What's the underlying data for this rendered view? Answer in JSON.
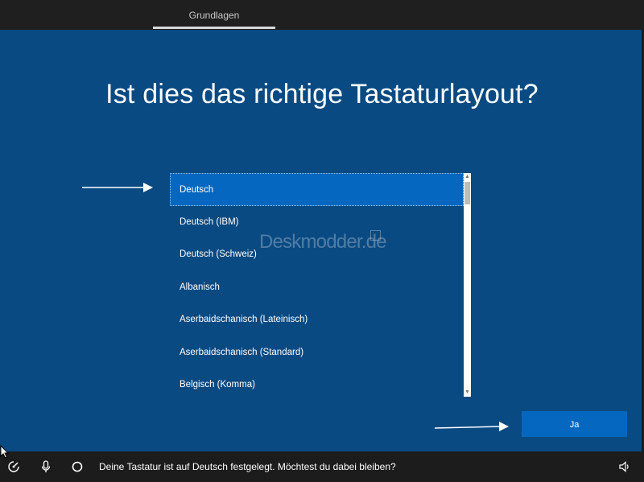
{
  "header": {
    "tab_label": "Grundlagen"
  },
  "main": {
    "title": "Ist dies das richtige Tastaturlayout?",
    "layouts": [
      "Deutsch",
      "Deutsch (IBM)",
      "Deutsch (Schweiz)",
      "Albanisch",
      "Aserbaidschanisch (Lateinisch)",
      "Aserbaidschanisch (Standard)",
      "Belgisch (Komma)"
    ],
    "selected_layout": "Deutsch",
    "confirm_button": "Ja",
    "watermark": "Deskmodder.de"
  },
  "footer": {
    "status_text": "Deine Tastatur ist auf Deutsch festgelegt. Möchtest du dabei bleiben?",
    "icons": [
      "ease-of-access-icon",
      "microphone-icon",
      "cortana-icon",
      "volume-icon"
    ]
  },
  "colors": {
    "background": "#0a4a82",
    "accent": "#0567bf",
    "bars": "#1c1c1c"
  }
}
